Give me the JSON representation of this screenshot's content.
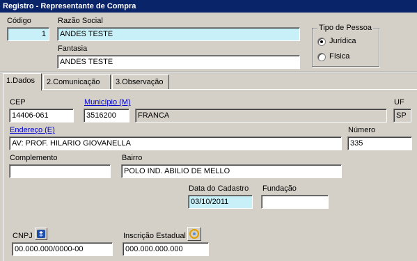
{
  "window": {
    "title": "Registro - Representante de Compra"
  },
  "header": {
    "codigo": {
      "label": "Código",
      "value": "1"
    },
    "razao_social": {
      "label": "Razão Social",
      "value": "ANDES TESTE"
    },
    "fantasia": {
      "label": "Fantasia",
      "value": "ANDES TESTE"
    },
    "tipo_pessoa": {
      "title": "Tipo de Pessoa",
      "options": [
        {
          "label": "Jurídica",
          "selected": true
        },
        {
          "label": "Física",
          "selected": false
        }
      ]
    }
  },
  "tabs": [
    {
      "label": "1.Dados",
      "active": true
    },
    {
      "label": "2.Comunicação",
      "active": false
    },
    {
      "label": "3.Observação",
      "active": false
    }
  ],
  "dados": {
    "cep": {
      "label": "CEP",
      "value": "14406-061"
    },
    "municipio": {
      "label": "Município (M)",
      "code": "3516200",
      "name": "FRANCA"
    },
    "uf": {
      "label": "UF",
      "value": "SP"
    },
    "endereco": {
      "label": "Endereço (E)",
      "value": "AV: PROF. HILARIO GIOVANELLA"
    },
    "numero": {
      "label": "Número",
      "value": "335"
    },
    "complemento": {
      "label": "Complemento",
      "value": ""
    },
    "bairro": {
      "label": "Bairro",
      "value": "POLO IND. ABILIO DE MELLO"
    },
    "data_cadastro": {
      "label": "Data do Cadastro",
      "value": "03/10/2011"
    },
    "fundacao": {
      "label": "Fundação",
      "value": ""
    },
    "cnpj": {
      "label": "CNPJ",
      "value": "00.000.000/0000-00"
    },
    "inscricao_estadual": {
      "label": "Inscrição Estadual",
      "value": "000.000.000.000"
    }
  },
  "colors": {
    "titlebar": "#0a246a",
    "highlight_field": "#c8f0f8",
    "link": "#0000cc"
  }
}
